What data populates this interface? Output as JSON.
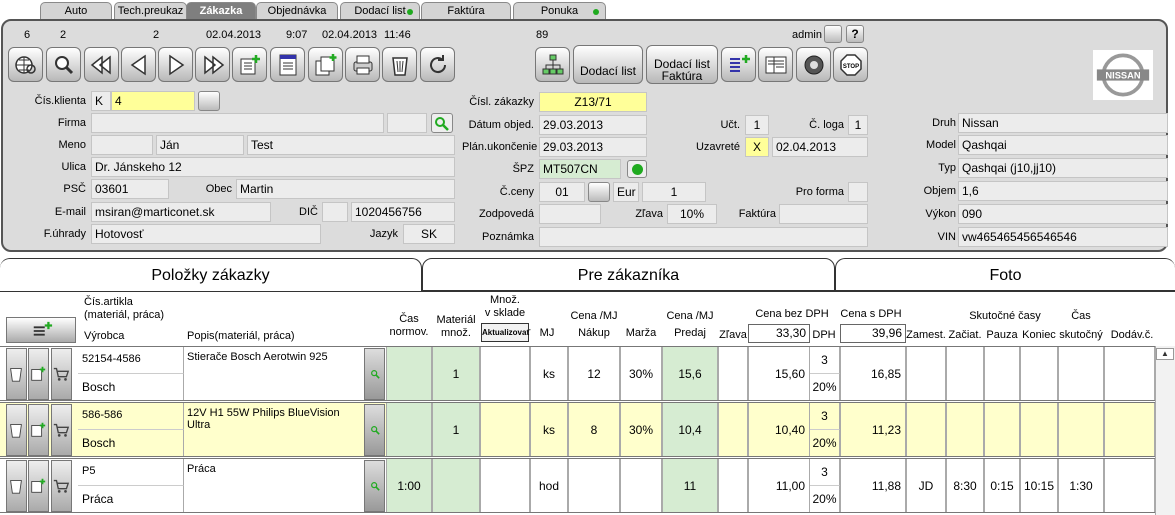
{
  "tabs": [
    {
      "label": "Auto",
      "dot": false
    },
    {
      "label": "Tech.preukaz",
      "dot": false
    },
    {
      "label": "Zákazka",
      "dot": false,
      "active": true
    },
    {
      "label": "Objednávka",
      "dot": false
    },
    {
      "label": "Dodací list",
      "dot": true
    },
    {
      "label": "Faktúra",
      "dot": false
    },
    {
      "label": "Ponuka",
      "dot": true
    }
  ],
  "counters": {
    "n1": "6",
    "n2": "2",
    "n3": "2",
    "d1": "02.04.2013",
    "t1": "9:07",
    "d2": "02.04.2013",
    "t2": "11:46",
    "n89": "89",
    "user": "admin"
  },
  "buttons": {
    "dodaci": "Dodací list",
    "dodaci_fakt_1": "Dodací list",
    "dodaci_fakt_2": "Faktúra"
  },
  "logo": "NISSAN",
  "customer": {
    "l_klient": "Čís.klienta",
    "klient_k": "K",
    "klient": "4",
    "l_firma": "Firma",
    "firma": "",
    "l_meno": "Meno",
    "meno": "Ján",
    "priezvisko": "Test",
    "l_ulica": "Ulica",
    "ulica": "Dr. Jánskeho 12",
    "l_psc": "PSČ",
    "psc": "03601",
    "l_obec": "Obec",
    "obec": "Martin",
    "l_email": "E-mail",
    "email": "msiran@marticonet.sk",
    "l_dic": "DIČ",
    "dic": "1020456756",
    "l_uhrada": "F.úhrady",
    "uhrada": "Hotovosť",
    "l_jazyk": "Jazyk",
    "jazyk": "SK"
  },
  "order": {
    "l_cislo": "Čísl. zákazky",
    "cislo": "Z13/71",
    "l_datum": "Dátum objed.",
    "datum": "29.03.2013",
    "l_plan": "Plán.ukončenie",
    "plan": "29.03.2013",
    "l_spz": "ŠPZ",
    "spz": "MT507CN",
    "l_ceny": "Č.ceny",
    "ceny": "01",
    "mena": "Eur",
    "kurz": "1",
    "l_zodp": "Zodpovedá",
    "l_zlava": "Zľava",
    "zlava": "10%",
    "l_fakt": "Faktúra",
    "l_pozn": "Poznámka",
    "l_uct": "Učt.",
    "uct": "1",
    "l_loga": "Č. loga",
    "loga": "1",
    "l_uzav": "Uzavreté",
    "uzav": "X",
    "uzav_d": "02.04.2013",
    "l_proforma": "Pro forma"
  },
  "vehicle": {
    "l_druh": "Druh",
    "druh": "Nissan",
    "l_model": "Model",
    "model": "Qashqai",
    "l_typ": "Typ",
    "typ": "Qashqai (j10,jj10)",
    "l_objem": "Objem",
    "objem": "1,6",
    "l_vykon": "Výkon",
    "vykon": "090",
    "l_vin": "VIN",
    "vin": "vw465465456546546"
  },
  "ptabs": [
    "Položky zákazky",
    "Pre zákazníka",
    "Foto"
  ],
  "header": {
    "cislo": "Čís.artikla",
    "cislo2": "(materiál, práca)",
    "vyrobca": "Výrobca",
    "popis": "Popis(materiál, práca)",
    "cas": "Čas",
    "cas2": "normov.",
    "mat": "Materiál",
    "mat2": "množ.",
    "mnoz": "Množ.",
    "mnoz2": "v sklade",
    "akt": "Aktualizovať",
    "mj": "MJ",
    "cena_mj": "Cena /MJ",
    "nakup": "Nákup",
    "marza": "Marža",
    "cena_mj2": "Cena /MJ",
    "predaj": "Predaj",
    "zlava": "Zľava",
    "bez_dph": "Cena bez DPH",
    "bez_val": "33,30",
    "dph": "DPH",
    "s_dph": "Cena s DPH",
    "s_val": "39,96",
    "zamest": "Zamest.",
    "skut": "Skutočné časy",
    "zaciat": "Začiat.",
    "pauza": "Pauza",
    "koniec": "Koniec",
    "cas_s": "Čas",
    "cas_s2": "skutočný",
    "dodav": "Dodáv.č."
  },
  "rows": [
    {
      "art": "52154-4586",
      "vyr": "Bosch",
      "popis": "Stierače Bosch Aerotwin 925",
      "cas": "",
      "mnoz": "1",
      "mj": "ks",
      "nakup": "12",
      "marza": "30%",
      "predaj": "15,6",
      "bez": "15,60",
      "dph1": "3",
      "dph2": "20%",
      "s": "16,85",
      "zam": "",
      "zac": "",
      "pau": "",
      "kon": "",
      "cs": ""
    },
    {
      "art": "586-586",
      "vyr": "Bosch",
      "popis": "12V H1 55W Philips BlueVision Ultra",
      "cas": "",
      "mnoz": "1",
      "mj": "ks",
      "nakup": "8",
      "marza": "30%",
      "predaj": "10,4",
      "bez": "10,40",
      "dph1": "3",
      "dph2": "20%",
      "s": "11,23",
      "zam": "",
      "zac": "",
      "pau": "",
      "kon": "",
      "cs": ""
    },
    {
      "art": "P5",
      "vyr": "Práca",
      "popis": "Práca",
      "cas": "1:00",
      "mnoz": "",
      "mj": "hod",
      "nakup": "",
      "marza": "",
      "predaj": "11",
      "bez": "11,00",
      "dph1": "3",
      "dph2": "20%",
      "s": "11,88",
      "zam": "JD",
      "zac": "8:30",
      "pau": "0:15",
      "kon": "10:15",
      "cs": "1:30"
    }
  ]
}
